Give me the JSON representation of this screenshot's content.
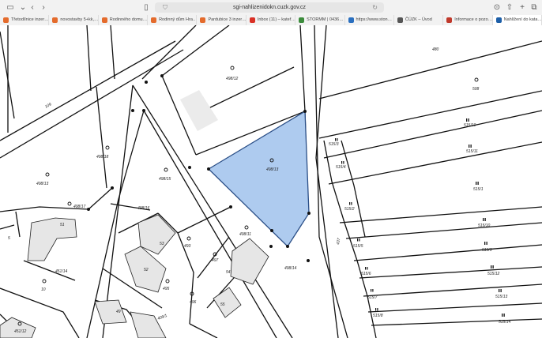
{
  "browser": {
    "url": "sgi-nahlizenidokn.cuzk.gov.cz",
    "tabs": [
      {
        "label": "Třetodílnice inzer…",
        "color": "#e46b2c"
      },
      {
        "label": "novostavby 5+kk,…",
        "color": "#e46b2c"
      },
      {
        "label": "Rodinného domu…",
        "color": "#e46b2c"
      },
      {
        "label": "Rodinný dům Hra…",
        "color": "#e46b2c"
      },
      {
        "label": "Pardubice 3 inzer…",
        "color": "#e46b2c"
      },
      {
        "label": "Inbox (11) – kateř…",
        "color": "#d93025"
      },
      {
        "label": "STORMM | 0436…",
        "color": "#3c8c3c"
      },
      {
        "label": "https://www.ston…",
        "color": "#2a6fbf"
      },
      {
        "label": "ČÚZK – Úvod",
        "color": "#555555"
      },
      {
        "label": "Informace o pozo…",
        "color": "#c0392b"
      },
      {
        "label": "Nahlížení do kata…",
        "color": "#1d5fa8"
      }
    ]
  },
  "map": {
    "highlight_color": "#aecbef",
    "parcels": [
      {
        "id": "p1",
        "text": "498/12"
      },
      {
        "id": "p2",
        "text": "480"
      },
      {
        "id": "p3",
        "text": "508"
      },
      {
        "id": "p4",
        "text": "515/10"
      },
      {
        "id": "p5",
        "text": "515/11"
      },
      {
        "id": "p6",
        "text": "515/3"
      },
      {
        "id": "p7",
        "text": "515/4"
      },
      {
        "id": "p8",
        "text": "515/1"
      },
      {
        "id": "p9",
        "text": "515/2"
      },
      {
        "id": "p10",
        "text": "515/10"
      },
      {
        "id": "p11",
        "text": "515/9"
      },
      {
        "id": "p12",
        "text": "515/5"
      },
      {
        "id": "p13",
        "text": "515/12"
      },
      {
        "id": "p14",
        "text": "515/6"
      },
      {
        "id": "p15",
        "text": "515/13"
      },
      {
        "id": "p16",
        "text": "515/7"
      },
      {
        "id": "p17",
        "text": "515/8"
      },
      {
        "id": "p18",
        "text": "515/14"
      },
      {
        "id": "p19",
        "text": "498/13"
      },
      {
        "id": "p20",
        "text": "498/18"
      },
      {
        "id": "p21",
        "text": "498/13"
      },
      {
        "id": "p22",
        "text": "498/15"
      },
      {
        "id": "p23",
        "text": "498/16"
      },
      {
        "id": "p24",
        "text": "498/17"
      },
      {
        "id": "p25",
        "text": "498/11"
      },
      {
        "id": "p26",
        "text": "498/14"
      },
      {
        "id": "p27",
        "text": "51"
      },
      {
        "id": "p28",
        "text": "451/14"
      },
      {
        "id": "p29",
        "text": "10"
      },
      {
        "id": "p30",
        "text": "53"
      },
      {
        "id": "p31",
        "text": "493"
      },
      {
        "id": "p32",
        "text": "52"
      },
      {
        "id": "p33",
        "text": "497"
      },
      {
        "id": "p34",
        "text": "54"
      },
      {
        "id": "p35",
        "text": "495"
      },
      {
        "id": "p36",
        "text": "496"
      },
      {
        "id": "p37",
        "text": "55"
      },
      {
        "id": "p38",
        "text": "49"
      },
      {
        "id": "p39",
        "text": "451/12"
      },
      {
        "id": "p40",
        "text": "437"
      },
      {
        "id": "p41",
        "text": "109"
      },
      {
        "id": "p42",
        "text": "409/1"
      },
      {
        "id": "p43",
        "text": "5"
      }
    ]
  }
}
